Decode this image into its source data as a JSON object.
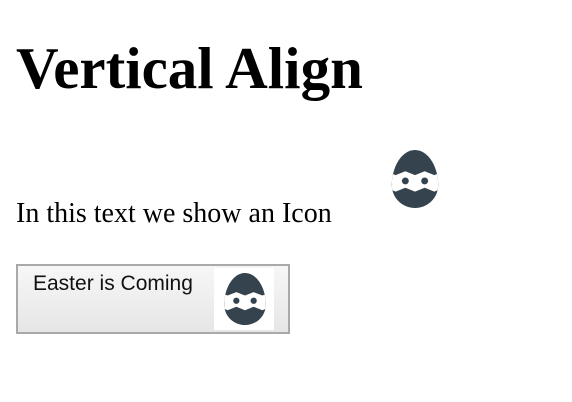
{
  "heading": {
    "title": "Vertical Align"
  },
  "paragraph": {
    "text": "In this text we show an Icon",
    "icon": "easter-egg-icon"
  },
  "button": {
    "label": "Easter is Coming",
    "icon": "easter-egg-icon"
  },
  "colors": {
    "icon_fill": "#34434d",
    "button_border": "#a9a9a9",
    "button_bg_top": "#f7f7f7",
    "button_bg_bottom": "#e6e6e6"
  }
}
